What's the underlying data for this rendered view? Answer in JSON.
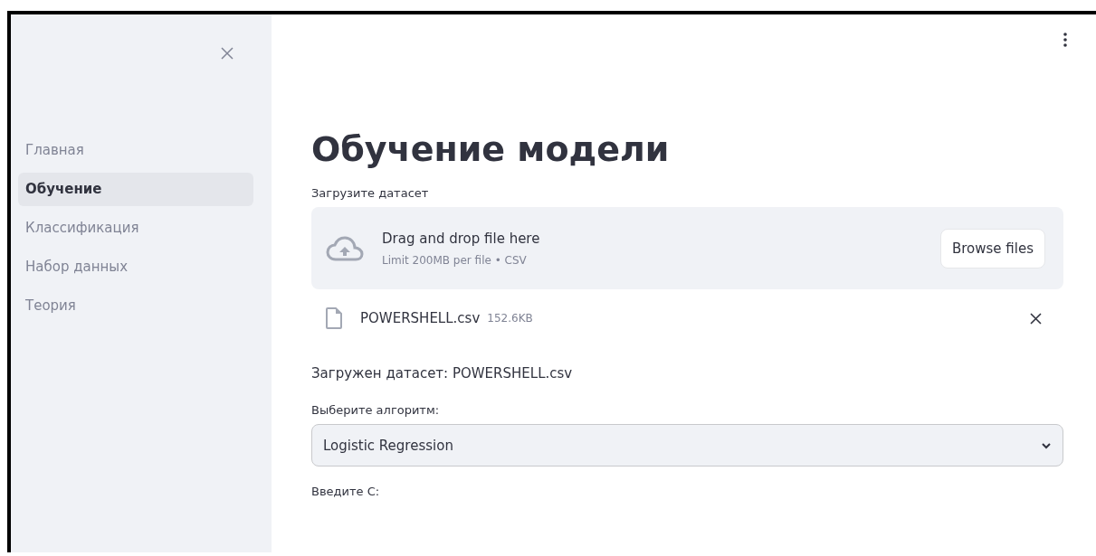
{
  "sidebar": {
    "items": [
      {
        "label": "Главная",
        "selected": false
      },
      {
        "label": "Обучение",
        "selected": true
      },
      {
        "label": "Классификация",
        "selected": false
      },
      {
        "label": "Набор данных",
        "selected": false
      },
      {
        "label": "Теория",
        "selected": false
      }
    ]
  },
  "main": {
    "title": "Обучение модели",
    "uploader": {
      "label": "Загрузите датасет",
      "prompt": "Drag and drop file here",
      "limit": "Limit 200MB per file • CSV",
      "button": "Browse files"
    },
    "file": {
      "name": "POWERSHELL.csv",
      "size": "152.6KB"
    },
    "status": "Загружен датасет: POWERSHELL.csv",
    "algorithm": {
      "label": "Выберите алгоритм:",
      "value": "Logistic Regression"
    },
    "c_label": "Введите C:"
  }
}
